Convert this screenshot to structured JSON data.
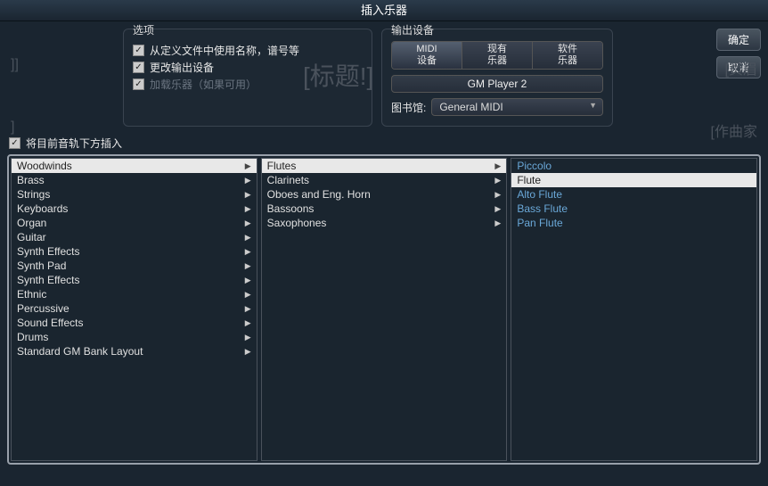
{
  "title": "插入乐器",
  "bg": {
    "title": "[标题!]",
    "page": "[页眉",
    "composer": "[作曲家",
    "left1": "]]",
    "left2": "]"
  },
  "options": {
    "label": "选项",
    "use_name": {
      "label": "从定义文件中使用名称，谱号等",
      "checked": true
    },
    "change_output": {
      "label": "更改输出设备",
      "checked": true
    },
    "load_instrument": {
      "label": "加载乐器（如果可用）",
      "checked": true,
      "disabled": true
    }
  },
  "outputs": {
    "label": "输出设备",
    "seg": [
      {
        "line1": "MIDI",
        "line2": "设备",
        "active": true
      },
      {
        "line1": "现有",
        "line2": "乐器",
        "active": false
      },
      {
        "line1": "软件",
        "line2": "乐器",
        "active": false
      }
    ],
    "player": "GM Player 2",
    "library_label": "图书馆:",
    "library_value": "General MIDI"
  },
  "buttons": {
    "ok": "确定",
    "cancel": "取消"
  },
  "insert_below": {
    "label": "将目前音轨下方插入",
    "checked": true
  },
  "col1": {
    "selected": 0,
    "items": [
      "Woodwinds",
      "Brass",
      "Strings",
      "Keyboards",
      "Organ",
      "Guitar",
      "Synth Effects",
      "Synth Pad",
      "Synth Effects",
      "Ethnic",
      "Percussive",
      "Sound Effects",
      "Drums",
      "Standard GM Bank Layout"
    ]
  },
  "col2": {
    "selected": 0,
    "items": [
      "Flutes",
      "Clarinets",
      "Oboes and Eng. Horn",
      "Bassoons",
      "Saxophones"
    ]
  },
  "col3": {
    "selected": 1,
    "items": [
      "Piccolo",
      "Flute",
      "Alto Flute",
      "Bass Flute",
      "Pan Flute"
    ]
  }
}
